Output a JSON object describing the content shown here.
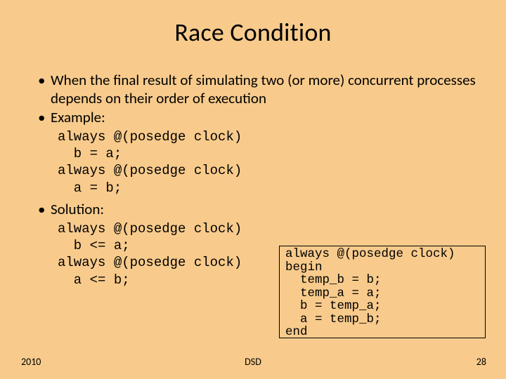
{
  "title": "Race Condition",
  "bullets": {
    "b1": "When the final result of simulating two (or more) concurrent processes depends on their order of execution",
    "b2": "Example:",
    "b3": "Solution:"
  },
  "code_example": "always @(posedge clock)\n  b = a;\nalways @(posedge clock)\n  a = b;",
  "code_solution": "always @(posedge clock)\n  b <= a;\nalways @(posedge clock)\n  a <= b;",
  "code_box": "always @(posedge clock)\nbegin\n  temp_b = b;\n  temp_a = a;\n  b = temp_a;\n  a = temp_b;\nend",
  "footer": {
    "left": "2010",
    "center": "DSD",
    "right": "28"
  }
}
